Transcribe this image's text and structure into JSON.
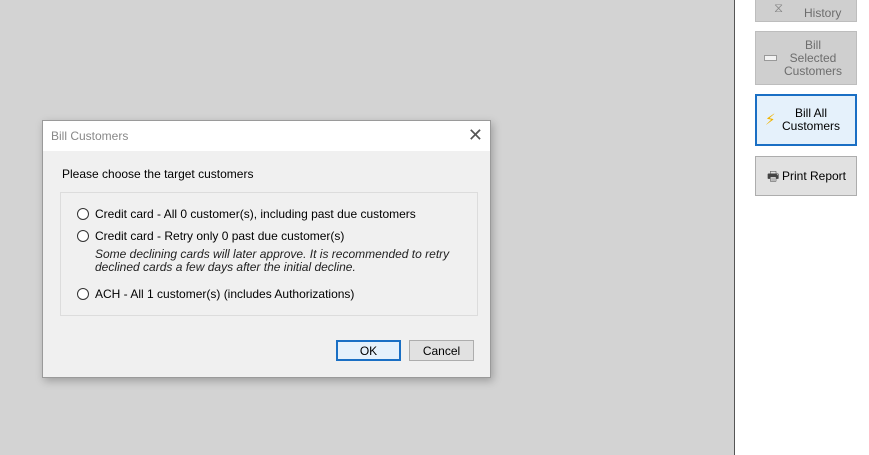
{
  "side_panel": {
    "history_label": "History",
    "bill_selected_label": "Bill Selected Customers",
    "bill_all_label": "Bill All Customers",
    "print_report_label": "Print Report"
  },
  "dialog": {
    "title": "Bill Customers",
    "close_symbol": "✕",
    "prompt": "Please choose the target customers",
    "options": [
      {
        "label": "Credit card - All 0 customer(s), including past due customers",
        "selected": false
      },
      {
        "label": "Credit card - Retry only 0 past due customer(s)",
        "selected": false
      },
      {
        "label": "ACH - All 1 customer(s) (includes Authorizations)",
        "selected": false
      }
    ],
    "retry_note": "Some declining cards will later approve.  It is recommended to retry declined cards a few days after the initial decline.",
    "ok_label": "OK",
    "cancel_label": "Cancel"
  },
  "icons": {
    "history": "history-icon",
    "bill_selected": "bill-selected-icon",
    "bill_all": "lightning-icon",
    "print": "printer-icon",
    "close": "close-icon"
  },
  "colors": {
    "focus_border": "#1a6fc4",
    "lightning": "#f0b400",
    "backdrop": "#d3d3d3"
  }
}
